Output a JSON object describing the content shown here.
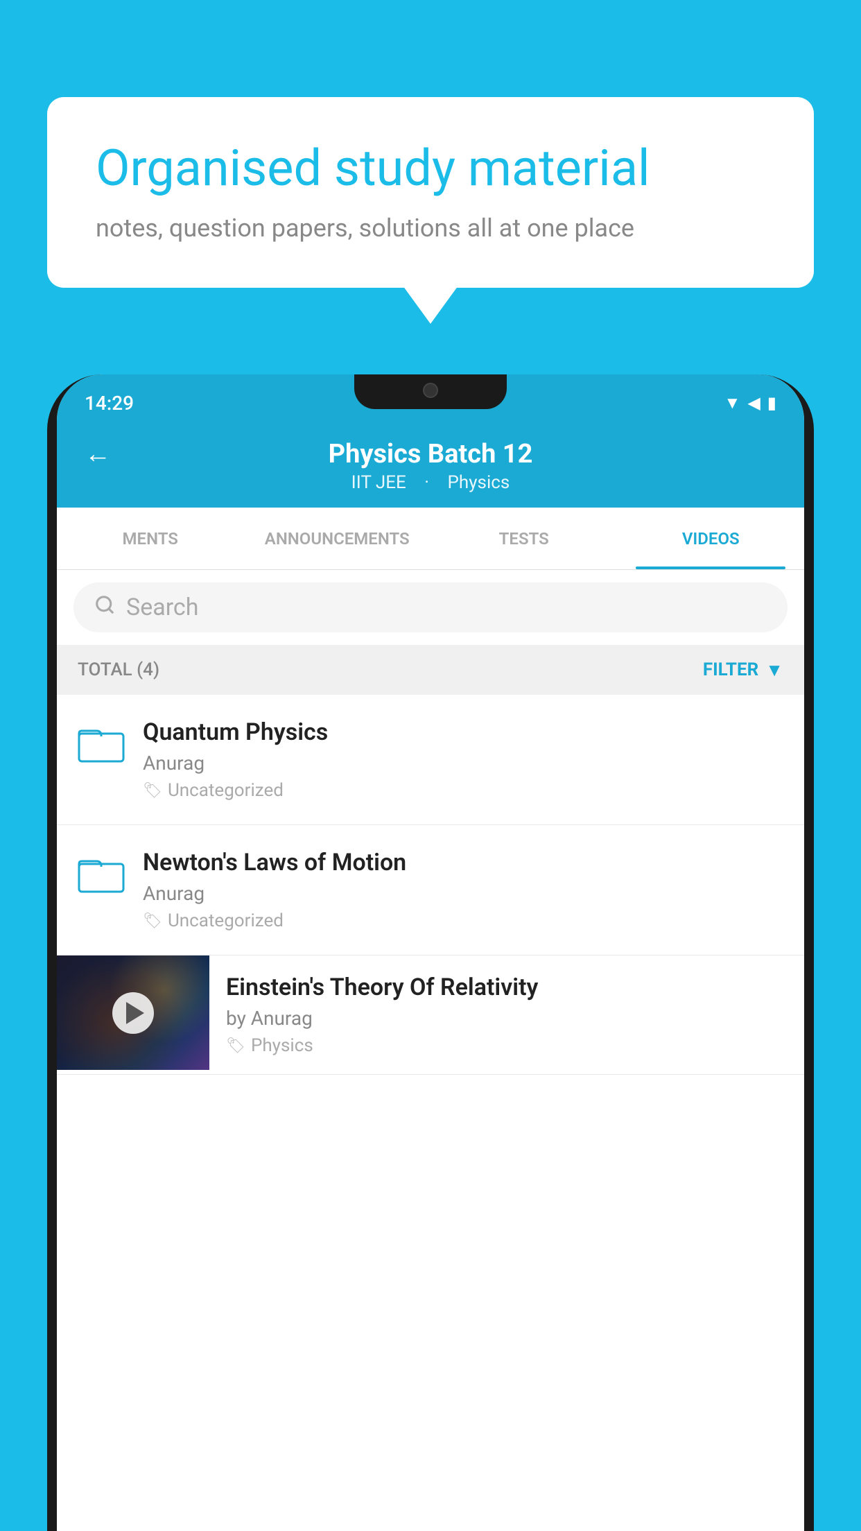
{
  "background": {
    "color": "#1bbde8"
  },
  "speech_bubble": {
    "title": "Organised study material",
    "subtitle": "notes, question papers, solutions all at one place"
  },
  "status_bar": {
    "time": "14:29",
    "icons": [
      "wifi",
      "signal",
      "battery"
    ]
  },
  "app_header": {
    "title": "Physics Batch 12",
    "subtitle_part1": "IIT JEE",
    "subtitle_part2": "Physics",
    "back_label": "←"
  },
  "tabs": [
    {
      "label": "MENTS",
      "active": false
    },
    {
      "label": "ANNOUNCEMENTS",
      "active": false
    },
    {
      "label": "TESTS",
      "active": false
    },
    {
      "label": "VIDEOS",
      "active": true
    }
  ],
  "search": {
    "placeholder": "Search"
  },
  "filter_bar": {
    "total_label": "TOTAL (4)",
    "filter_label": "FILTER"
  },
  "list_items": [
    {
      "title": "Quantum Physics",
      "author": "Anurag",
      "tag": "Uncategorized",
      "type": "folder"
    },
    {
      "title": "Newton's Laws of Motion",
      "author": "Anurag",
      "tag": "Uncategorized",
      "type": "folder"
    },
    {
      "title": "Einstein's Theory Of Relativity",
      "author": "by Anurag",
      "tag": "Physics",
      "type": "video"
    }
  ]
}
